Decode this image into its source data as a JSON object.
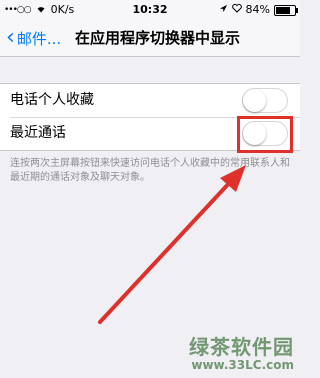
{
  "status_bar": {
    "signal": "•••○○",
    "carrier_speed": "0K/s",
    "time": "10:32",
    "battery_percent": "84%",
    "battery_level": 0.84
  },
  "nav": {
    "back_label": "邮件...",
    "title": "在应用程序切换器中显示"
  },
  "settings": {
    "rows": [
      {
        "label": "电话个人收藏",
        "enabled": false
      },
      {
        "label": "最近通话",
        "enabled": false
      }
    ],
    "footer": "连按两次主屏幕按钮来快速访问电话个人收藏中的常用联系人和最近期的通话对象及聊天对象。"
  },
  "annotation": {
    "color": "#e0302b"
  },
  "watermark": {
    "logo_text": "绿茶软件园",
    "url": "www.33LC.com"
  },
  "colors": {
    "accent": "#007aff",
    "background": "#efeff4"
  }
}
